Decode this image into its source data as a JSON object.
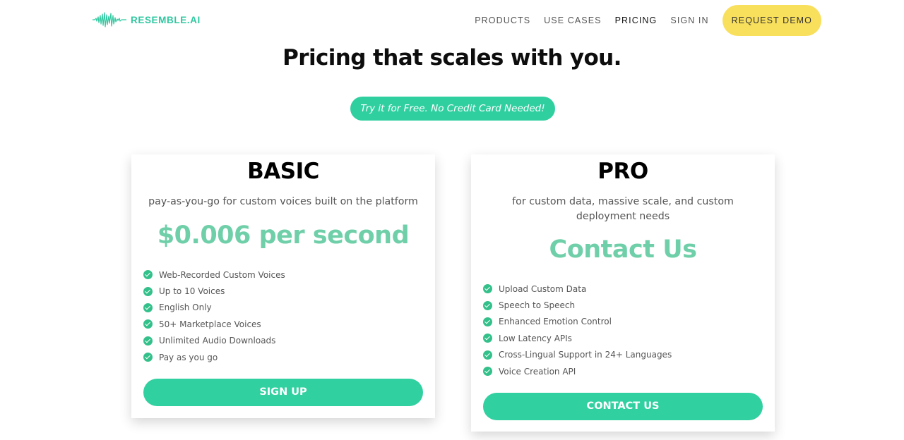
{
  "header": {
    "logo_text": "RESEMBLE.AI",
    "logo_icon": "waveform-icon",
    "nav": [
      {
        "label": "PRODUCTS"
      },
      {
        "label": "USE CASES"
      },
      {
        "label": "PRICING"
      },
      {
        "label": "SIGN IN"
      }
    ],
    "demo_label": "REQUEST DEMO"
  },
  "hero": {
    "title": "Pricing that scales with you.",
    "free_pill": "Try it for Free. No Credit Card Needed!"
  },
  "plans": [
    {
      "name": "BASIC",
      "description": "pay-as-you-go for custom voices built on the platform",
      "price": "$0.006 per second",
      "features": [
        "Web-Recorded Custom Voices",
        "Up to 10 Voices",
        "English Only",
        "50+ Marketplace Voices",
        "Unlimited Audio Downloads",
        "Pay as you go"
      ],
      "cta": "SIGN UP"
    },
    {
      "name": "PRO",
      "description": "for custom data, massive scale, and custom deployment needs",
      "price": "Contact Us",
      "features": [
        "Upload Custom Data",
        "Speech to Speech",
        "Enhanced Emotion Control",
        "Low Latency APIs",
        "Cross-Lingual Support in 24+ Languages",
        "Voice Creation API"
      ],
      "cta": "CONTACT US"
    }
  ],
  "colors": {
    "brand": "#2fc8a0",
    "price": "#6fcfa9",
    "cta": "#31d0a0",
    "demo_button": "#f8df5c",
    "check": "#34c08a"
  }
}
